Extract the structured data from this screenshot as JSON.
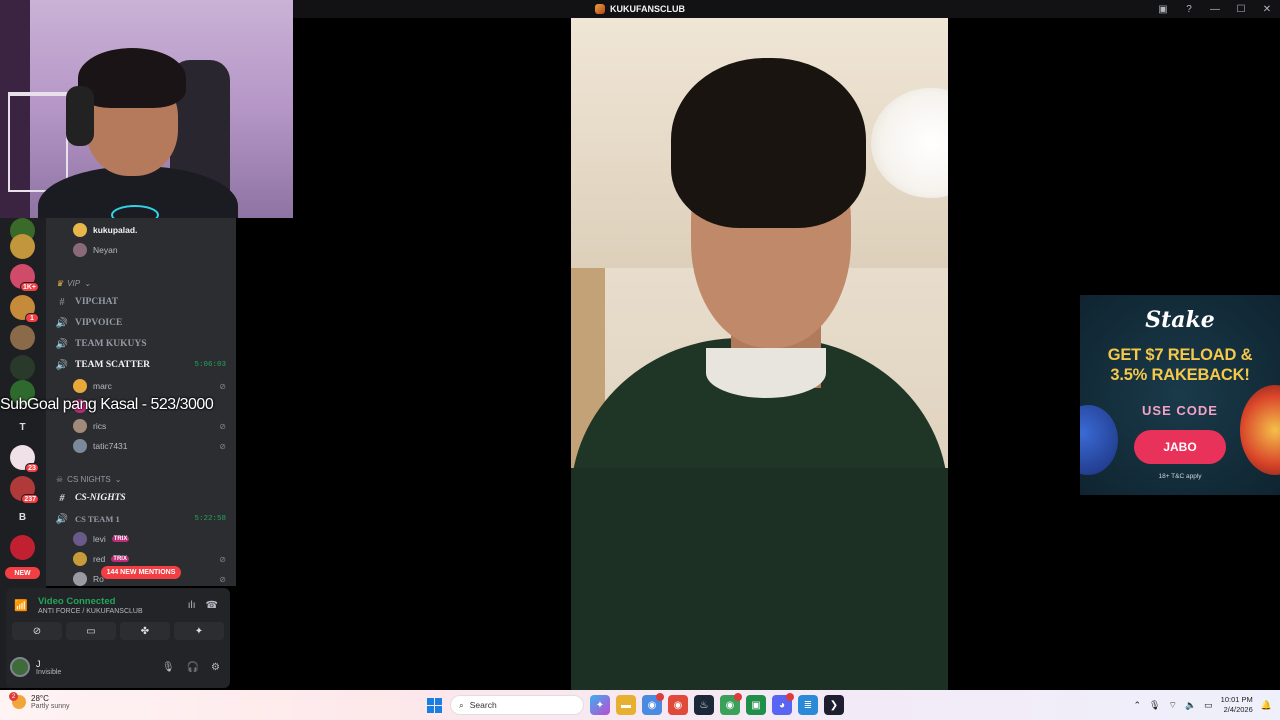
{
  "window": {
    "title": "KUKUFANSCLUB"
  },
  "overlay": {
    "subgoal": "SubGoal pang Kasal - 523/3000"
  },
  "rail": {
    "servers": [
      {
        "label": "",
        "badge": "1K+",
        "color": "#d04a6a"
      },
      {
        "label": "",
        "badge": "1",
        "color": "#c58a3a"
      },
      {
        "label": "",
        "badge": "",
        "color": "#8b6a4a"
      },
      {
        "label": "",
        "badge": "",
        "color": "#2a3a2a"
      },
      {
        "label": "T",
        "badge": "",
        "color": "#1e1f22"
      },
      {
        "label": "",
        "badge": "23",
        "color": "#f0e0e8"
      },
      {
        "label": "",
        "badge": "237",
        "color": "#b03a3a"
      },
      {
        "label": "B",
        "badge": "",
        "color": "#1e1f22"
      },
      {
        "label": "",
        "badge": "",
        "color": "#c02030"
      }
    ],
    "new_label": "NEW"
  },
  "channels": {
    "top_users": [
      {
        "name": "kukupalad.",
        "color": "#e8b64a"
      },
      {
        "name": "Neyan",
        "color": "#8a6a7a"
      }
    ],
    "vip_category": "VIP",
    "vip_channels": [
      {
        "name": "VIPCHAT",
        "kind": "text"
      },
      {
        "name": "VIPVOICE",
        "kind": "voice"
      },
      {
        "name": "TEAM KUKUYS",
        "kind": "voice"
      },
      {
        "name": "TEAM SCATTER",
        "kind": "voice",
        "time": "5:06:03"
      }
    ],
    "scatter_users": [
      {
        "name": "marc",
        "color": "#e8a83a"
      },
      {
        "name": "",
        "color": "#c02a78"
      },
      {
        "name": "rics",
        "color": "#a08a7a"
      },
      {
        "name": "tatic7431",
        "color": "#7a8a9a"
      }
    ],
    "cs_category": "CS NIGHTS",
    "cs_text": "CS-NIGHTS",
    "cs_voice": {
      "name": "CS TEAM 1",
      "time": "5:22:58"
    },
    "cs_users": [
      {
        "name": "levi",
        "tag": "TRIX",
        "color": "#6a5a8a"
      },
      {
        "name": "red",
        "tag": "TRIX",
        "color": "#c89a3a"
      },
      {
        "name": "Ro",
        "tag": "",
        "color": "#9a9aa2"
      }
    ],
    "mentions": "144 NEW MENTIONS"
  },
  "voice": {
    "status": "Video Connected",
    "location": "ANTI FORCE / KUKUFANSCLUB",
    "user_name": "J",
    "user_status": "Invisible"
  },
  "ad": {
    "brand": "Stake",
    "headline_1": "GET $7 RELOAD &",
    "headline_2": "3.5% RAKEBACK!",
    "code_label": "USE CODE",
    "cta": "JABO",
    "terms": "18+ T&C apply"
  },
  "taskbar": {
    "weather_temp": "28°C",
    "weather_desc": "Partly sunny",
    "weather_badge": "2",
    "search_label": "Search",
    "time": "10:01 PM",
    "date": "2/4/2026"
  },
  "colors": {
    "green": "#23a55a",
    "red": "#f23f43",
    "discord_bg": "#2b2d31"
  }
}
